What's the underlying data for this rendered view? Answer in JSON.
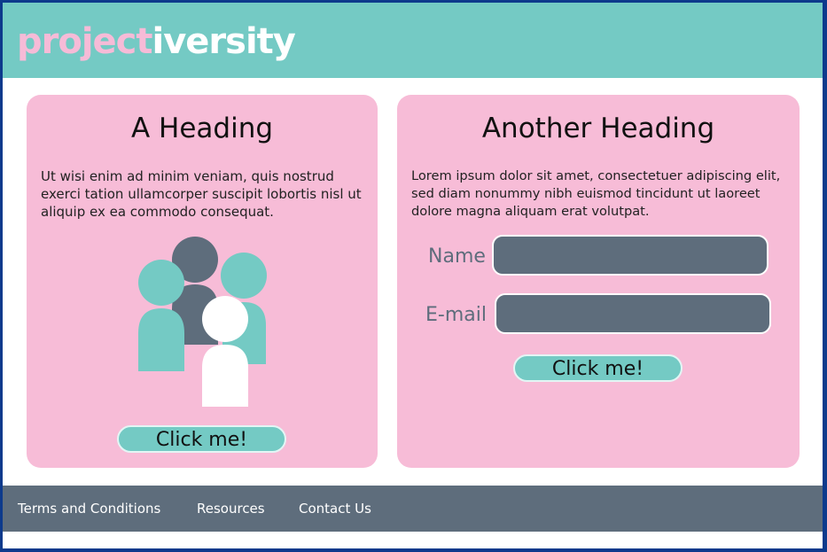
{
  "header": {
    "logo_part1": "project",
    "logo_part2": "iversity"
  },
  "card_left": {
    "heading": "A Heading",
    "text": "Ut wisi enim ad minim veniam, quis nostrud exerci tation ullamcorper suscipit lobortis nisl ut aliquip ex ea commodo consequat.",
    "button_label": "Click me!",
    "illustration_icon": "people-group-icon"
  },
  "card_right": {
    "heading": "Another Heading",
    "text": "Lorem ipsum dolor sit amet, consectetuer adipiscing elit, sed diam nonummy nibh euismod tincidunt ut laoreet dolore magna aliquam erat volutpat.",
    "name_label": "Name",
    "email_label": "E-mail",
    "button_label": "Click me!"
  },
  "footer": {
    "links": [
      "Terms and Conditions",
      "Resources",
      "Contact Us"
    ]
  },
  "colors": {
    "teal": "#74cac4",
    "pink": "#f7bcd7",
    "slate": "#5e6d7c",
    "white": "#ffffff"
  }
}
